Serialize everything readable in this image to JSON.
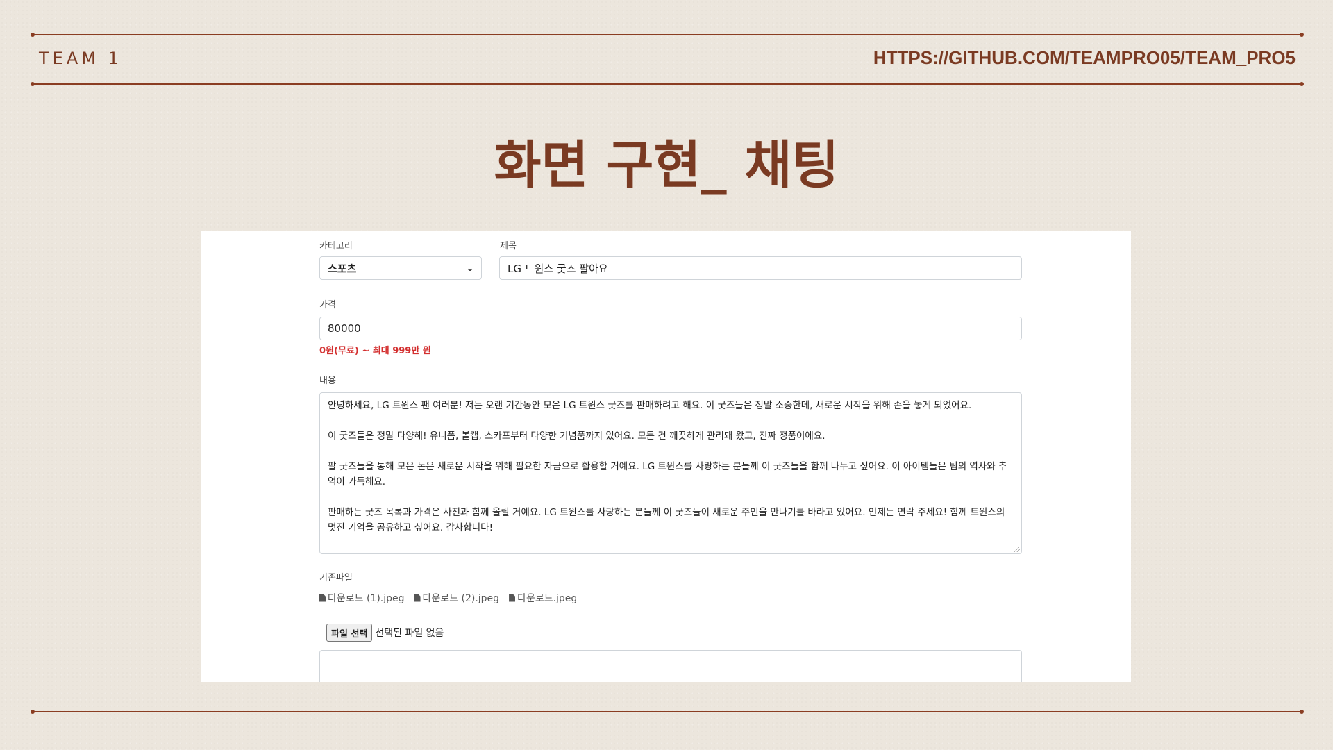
{
  "header": {
    "team": "TEAM 1",
    "repo_url": "HTTPS://GITHUB.COM/TEAMPRO05/TEAM_PRO5"
  },
  "slide": {
    "title": "화면 구현_ 채팅"
  },
  "form": {
    "category": {
      "label": "카테고리",
      "value": "스포츠"
    },
    "title_field": {
      "label": "제목",
      "value": "LG 트윈스 굿즈 팔아요"
    },
    "price": {
      "label": "가격",
      "value": "80000",
      "hint": "0원(무료) ~ 최대 999만 원"
    },
    "content": {
      "label": "내용",
      "paragraphs": [
        "안녕하세요, LG 트윈스 팬 여러분! 저는 오랜 기간동안 모은 LG 트윈스 굿즈를 판매하려고 해요. 이 굿즈들은 정말 소중한데, 새로운 시작을 위해 손을 놓게 되었어요.",
        "이 굿즈들은 정말 다양해! 유니폼, 볼캡, 스카프부터 다양한 기념품까지 있어요. 모든 건 깨끗하게 관리돼 왔고, 진짜 정품이에요.",
        "팔 굿즈들을 통해 모은 돈은 새로운 시작을 위해 필요한 자금으로 활용할 거예요. LG 트윈스를 사랑하는 분들께 이 굿즈들을 함께 나누고 싶어요. 이 아이템들은 팀의 역사와 추억이 가득해요.",
        "판매하는 굿즈 목록과 가격은 사진과 함께 올릴 거예요. LG 트윈스를 사랑하는 분들께 이 굿즈들이 새로운 주인을 만나기를 바라고 있어요. 언제든 연락 주세요! 함께 트윈스의 멋진 기억을 공유하고 싶어요. 감사합니다!"
      ]
    },
    "existing_files": {
      "label": "기존파일",
      "files": [
        "다운로드 (1).jpeg",
        "다운로드 (2).jpeg",
        "다운로드.jpeg"
      ]
    },
    "file_input": {
      "button_label": "파일 선택",
      "status": "선택된 파일 없음"
    }
  },
  "colors": {
    "accent": "#7a3a22",
    "rule": "#8a3d22",
    "hint": "#d32f2f",
    "background": "#ece6dd"
  }
}
